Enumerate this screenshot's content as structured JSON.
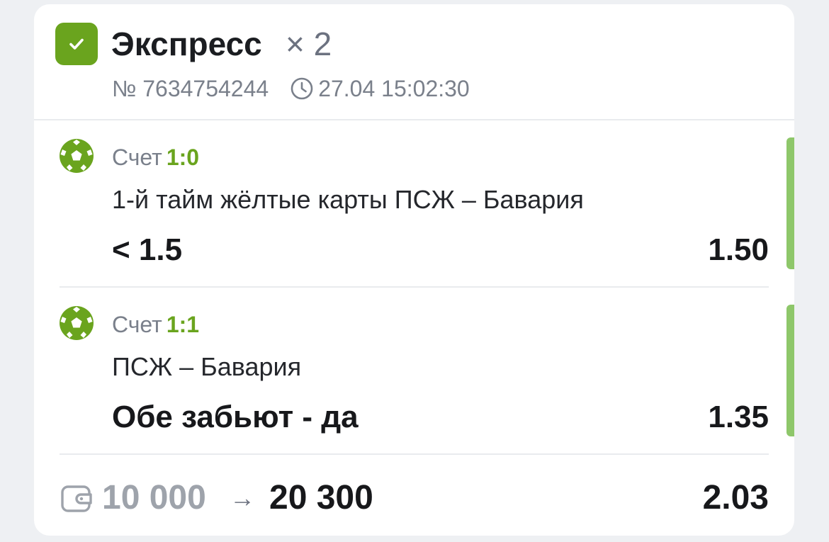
{
  "colors": {
    "accent_green": "#6aa41e",
    "win_bar": "#8ec76a",
    "badge_green": "#6aa41e"
  },
  "header": {
    "badge_icon": "check-icon",
    "title": "Экспресс",
    "multiplier": "× 2",
    "bet_number": "№ 7634754244",
    "clock_icon": "clock-icon",
    "datetime": "27.04 15:02:30"
  },
  "bets": [
    {
      "sport_icon": "soccer-ball-icon",
      "score_label": "Счет",
      "score": "1:0",
      "event": "1-й тайм жёлтые карты ПСЖ – Бавария",
      "outcome": "< 1.5",
      "odds": "1.50",
      "status": "won"
    },
    {
      "sport_icon": "soccer-ball-icon",
      "score_label": "Счет",
      "score": "1:1",
      "event": "ПСЖ – Бавария",
      "outcome": "Обе забьют - да",
      "odds": "1.35",
      "status": "won"
    }
  ],
  "footer": {
    "wallet_icon": "wallet-icon",
    "stake": "10 000",
    "arrow": "→",
    "payout": "20 300",
    "total_odds": "2.03"
  }
}
